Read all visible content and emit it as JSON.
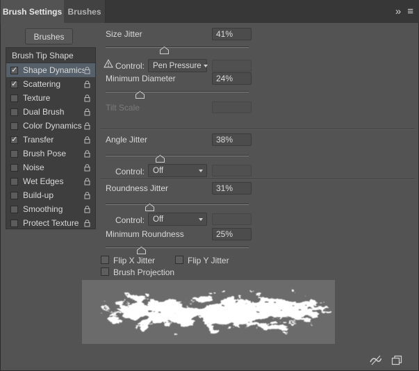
{
  "colors": {
    "panel_bg": "#535353",
    "selection": "#56606a",
    "preview_bg": "#6b6b6b"
  },
  "header": {
    "tabs": [
      {
        "label": "Brush Settings",
        "active": true
      },
      {
        "label": "Brushes",
        "active": false
      }
    ],
    "collapse_icon": "»",
    "menu_icon": "≡"
  },
  "sidebar": {
    "brushes_button_label": "Brushes",
    "tip_shape_label": "Brush Tip Shape",
    "items": [
      {
        "label": "Shape Dynamics",
        "checked": true,
        "selected": true
      },
      {
        "label": "Scattering",
        "checked": true,
        "selected": false
      },
      {
        "label": "Texture",
        "checked": false,
        "selected": false
      },
      {
        "label": "Dual Brush",
        "checked": false,
        "selected": false
      },
      {
        "label": "Color Dynamics",
        "checked": false,
        "selected": false
      },
      {
        "label": "Transfer",
        "checked": true,
        "selected": false
      },
      {
        "label": "Brush Pose",
        "checked": false,
        "selected": false
      },
      {
        "label": "Noise",
        "checked": false,
        "selected": false
      },
      {
        "label": "Wet Edges",
        "checked": false,
        "selected": false
      },
      {
        "label": "Build-up",
        "checked": false,
        "selected": false
      },
      {
        "label": "Smoothing",
        "checked": false,
        "selected": false
      },
      {
        "label": "Protect Texture",
        "checked": false,
        "selected": false
      }
    ]
  },
  "controls": {
    "size_jitter": {
      "label": "Size Jitter",
      "value": "41%"
    },
    "size_control": {
      "label": "Control:",
      "value": "Pen Pressure"
    },
    "minimum_diameter": {
      "label": "Minimum Diameter",
      "value": "24%"
    },
    "tilt_scale": {
      "label": "Tilt Scale",
      "value": ""
    },
    "angle_jitter": {
      "label": "Angle Jitter",
      "value": "38%"
    },
    "angle_control": {
      "label": "Control:",
      "value": "Off"
    },
    "roundness_jitter": {
      "label": "Roundness Jitter",
      "value": "31%"
    },
    "roundness_control": {
      "label": "Control:",
      "value": "Off"
    },
    "minimum_roundness": {
      "label": "Minimum Roundness",
      "value": "25%"
    },
    "flip_x_label": "Flip X Jitter",
    "flip_y_label": "Flip Y Jitter",
    "brush_projection_label": "Brush Projection"
  },
  "footer": {
    "icons": [
      {
        "name": "live-tip-brush-preview"
      },
      {
        "name": "create-new-brush"
      }
    ]
  }
}
